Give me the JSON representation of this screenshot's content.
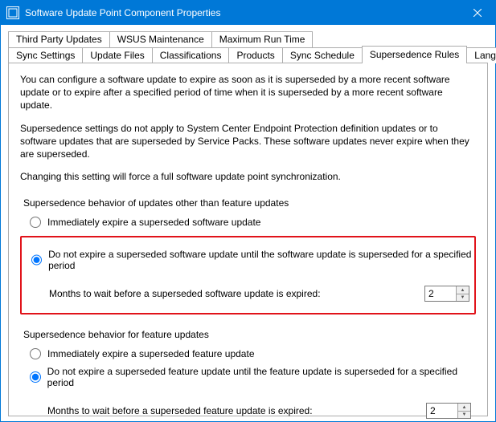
{
  "window": {
    "title": "Software Update Point Component Properties"
  },
  "tabs_top": [
    "Third Party Updates",
    "WSUS Maintenance",
    "Maximum Run Time"
  ],
  "tabs_bottom": [
    "Sync Settings",
    "Update Files",
    "Classifications",
    "Products",
    "Sync Schedule",
    "Supersedence Rules",
    "Languages"
  ],
  "content": {
    "desc1": "You can configure a software update to expire as soon as it is superseded by a more recent software update or to expire after a specified period of time when it is superseded by a more recent software update.",
    "desc2": "Supersedence settings do not apply to System Center Endpoint Protection definition updates or to software updates that are superseded by Service Packs. These software updates never expire when they are superseded.",
    "desc3": "Changing this setting will force a full software update point synchronization.",
    "group1_label": "Supersedence behavior of updates other than feature updates",
    "g1_opt1": "Immediately expire a superseded software update",
    "g1_opt2": "Do not expire a superseded software update until the software update is superseded for a specified period",
    "g1_months_label": "Months to wait before a superseded software update is expired:",
    "g1_months_value": "2",
    "group2_label": "Supersedence behavior for feature updates",
    "g2_opt1": "Immediately expire a superseded feature update",
    "g2_opt2": "Do not expire a superseded feature update until the feature update is superseded for a specified period",
    "g2_months_label": "Months to wait before a superseded feature update is expired:",
    "g2_months_value": "2"
  }
}
